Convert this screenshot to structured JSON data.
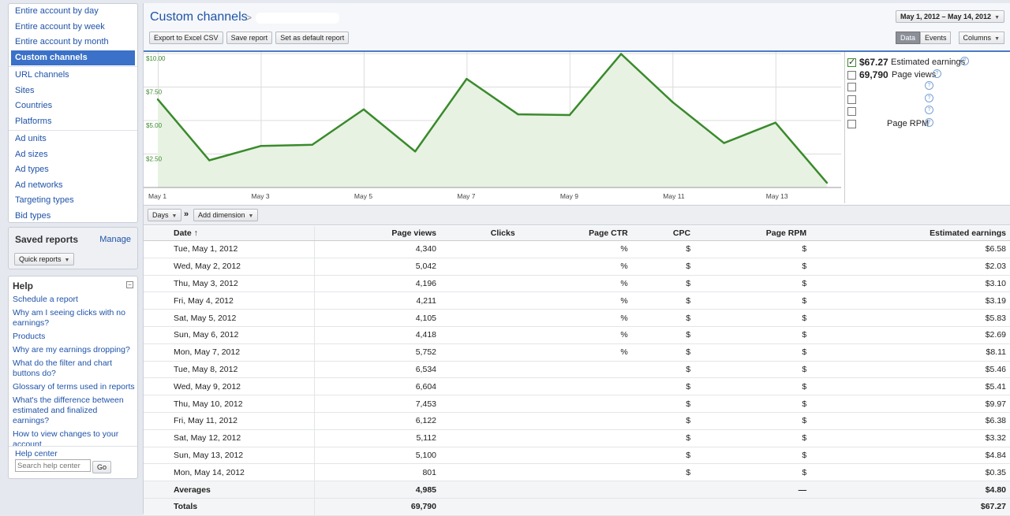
{
  "sidebar": {
    "nav": [
      {
        "label": "Entire account by day"
      },
      {
        "label": "Entire account by week"
      },
      {
        "label": "Entire account by month"
      },
      {
        "label": "Custom channels",
        "active": true
      },
      {
        "label": "URL channels"
      },
      {
        "label": "Sites"
      },
      {
        "label": "Countries"
      },
      {
        "label": "Platforms"
      },
      {
        "label": "Ad units"
      },
      {
        "label": "Ad sizes"
      },
      {
        "label": "Ad types"
      },
      {
        "label": "Ad networks"
      },
      {
        "label": "Targeting types"
      },
      {
        "label": "Bid types"
      }
    ],
    "saved_reports": {
      "title": "Saved reports",
      "manage": "Manage",
      "quick": "Quick reports"
    },
    "help": {
      "title": "Help",
      "links": [
        "Schedule a report",
        "Why am I seeing clicks with no earnings?",
        "Products",
        "Why are my earnings dropping?",
        "What do the filter and chart buttons do?",
        "Glossary of terms used in reports",
        "What's the difference between estimated and finalized earnings?",
        "How to view changes to your account"
      ],
      "center": "Help center",
      "search_placeholder": "Search help center",
      "go": "Go"
    }
  },
  "header": {
    "title": "Custom channels",
    "crumb_sep": ">",
    "export": "Export to Excel CSV",
    "save": "Save report",
    "set_default": "Set as default report",
    "date_range": "May 1, 2012 – May 14, 2012",
    "data": "Data",
    "events": "Events",
    "columns": "Columns"
  },
  "chart_data": {
    "type": "area",
    "x": [
      "May 1",
      "May 2",
      "May 3",
      "May 4",
      "May 5",
      "May 6",
      "May 7",
      "May 8",
      "May 9",
      "May 10",
      "May 11",
      "May 12",
      "May 13",
      "May 14"
    ],
    "x_tick_labels": [
      "May 1",
      "May 3",
      "May 5",
      "May 7",
      "May 9",
      "May 11",
      "May 13"
    ],
    "y_tick_labels": [
      "$10.00",
      "$7.50",
      "$5.00",
      "$2.50"
    ],
    "ylim": [
      0,
      10
    ],
    "series": [
      {
        "name": "Estimated earnings",
        "values": [
          6.58,
          2.03,
          3.1,
          3.19,
          5.83,
          2.69,
          8.11,
          5.46,
          5.41,
          9.97,
          6.38,
          3.32,
          4.84,
          0.35
        ]
      }
    ],
    "grid": true,
    "line_color": "#3a8a2c",
    "fill_color": "#e7f2e3"
  },
  "legend": [
    {
      "value": "$67.27",
      "label": "Estimated earnings",
      "checked": true
    },
    {
      "value": "69,790",
      "label": "Page views",
      "checked": false
    },
    {
      "value": "",
      "label": "",
      "checked": false
    },
    {
      "value": "",
      "label": "",
      "checked": false
    },
    {
      "value": "",
      "label": "",
      "checked": false
    },
    {
      "value": "",
      "label": "Page RPM",
      "checked": false
    }
  ],
  "table_bar": {
    "days": "Days",
    "arrow": "»",
    "add_dimension": "Add dimension"
  },
  "table": {
    "headers": [
      "Date ↑",
      "Page views",
      "Clicks",
      "Page CTR",
      "CPC",
      "Page RPM",
      "Estimated earnings"
    ],
    "rows": [
      [
        "Tue, May 1, 2012",
        "4,340",
        "",
        "%",
        "$",
        "$",
        "$6.58"
      ],
      [
        "Wed, May 2, 2012",
        "5,042",
        "",
        "%",
        "$",
        "$",
        "$2.03"
      ],
      [
        "Thu, May 3, 2012",
        "4,196",
        "",
        "%",
        "$",
        "$",
        "$3.10"
      ],
      [
        "Fri, May 4, 2012",
        "4,211",
        "",
        "%",
        "$",
        "$",
        "$3.19"
      ],
      [
        "Sat, May 5, 2012",
        "4,105",
        "",
        "%",
        "$",
        "$",
        "$5.83"
      ],
      [
        "Sun, May 6, 2012",
        "4,418",
        "",
        "%",
        "$",
        "$",
        "$2.69"
      ],
      [
        "Mon, May 7, 2012",
        "5,752",
        "",
        "%",
        "$",
        "$",
        "$8.11"
      ],
      [
        "Tue, May 8, 2012",
        "6,534",
        "",
        "",
        "$",
        "$",
        "$5.46"
      ],
      [
        "Wed, May 9, 2012",
        "6,604",
        "",
        "",
        "$",
        "$",
        "$5.41"
      ],
      [
        "Thu, May 10, 2012",
        "7,453",
        "",
        "",
        "$",
        "$",
        "$9.97"
      ],
      [
        "Fri, May 11, 2012",
        "6,122",
        "",
        "",
        "$",
        "$",
        "$6.38"
      ],
      [
        "Sat, May 12, 2012",
        "5,112",
        "",
        "",
        "$",
        "$",
        "$3.32"
      ],
      [
        "Sun, May 13, 2012",
        "5,100",
        "",
        "",
        "$",
        "$",
        "$4.84"
      ],
      [
        "Mon, May 14, 2012",
        "801",
        "",
        "",
        "$",
        "$",
        "$0.35"
      ]
    ],
    "averages": [
      "Averages",
      "4,985",
      "",
      "",
      "",
      "—",
      "$4.80"
    ],
    "totals": [
      "Totals",
      "69,790",
      "",
      "",
      "",
      "",
      "$67.27"
    ]
  }
}
